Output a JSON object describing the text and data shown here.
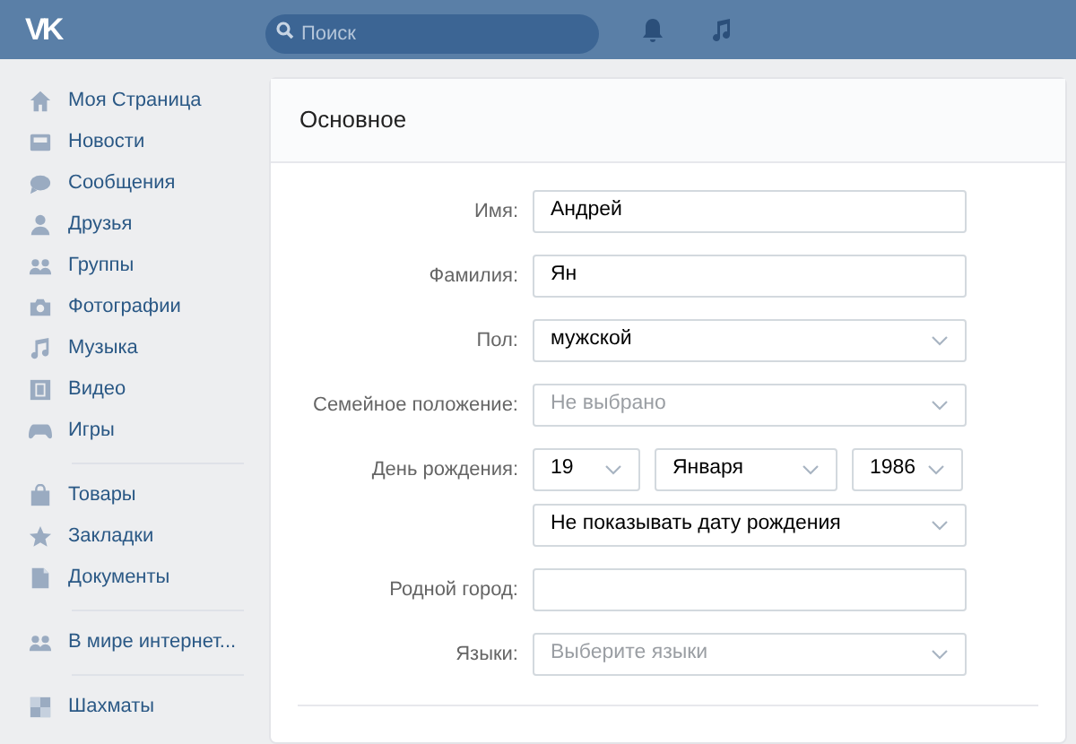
{
  "header": {
    "logo": "VK",
    "search": {
      "placeholder": "Поиск"
    }
  },
  "sidebar": {
    "groups": [
      {
        "items": [
          {
            "label": "Моя Страница"
          },
          {
            "label": "Новости"
          },
          {
            "label": "Сообщения"
          },
          {
            "label": "Друзья"
          },
          {
            "label": "Группы"
          },
          {
            "label": "Фотографии"
          },
          {
            "label": "Музыка"
          },
          {
            "label": "Видео"
          },
          {
            "label": "Игры"
          }
        ]
      },
      {
        "items": [
          {
            "label": "Товары"
          },
          {
            "label": "Закладки"
          },
          {
            "label": "Документы"
          }
        ]
      },
      {
        "items": [
          {
            "label": "В мире интернет..."
          }
        ]
      },
      {
        "items": [
          {
            "label": "Шахматы"
          }
        ]
      }
    ]
  },
  "card": {
    "title": "Основное",
    "rows": [
      {
        "label": "Имя:",
        "controls": [
          {
            "kind": "text",
            "value": "Андрей"
          }
        ]
      },
      {
        "label": "Фамилия:",
        "controls": [
          {
            "kind": "text",
            "value": "Ян"
          }
        ]
      },
      {
        "label": "Пол:",
        "controls": [
          {
            "kind": "select",
            "value": "мужской"
          }
        ]
      },
      {
        "label": "Семейное положение:",
        "controls": [
          {
            "kind": "select",
            "placeholder": "Не выбрано"
          }
        ]
      },
      {
        "label": "День рождения:",
        "controls": [
          {
            "kind": "select",
            "value": "19"
          },
          {
            "kind": "select",
            "value": "Января"
          },
          {
            "kind": "select",
            "value": "1986"
          }
        ]
      },
      {
        "controls": [
          {
            "kind": "select",
            "value": "Не показывать дату рождения"
          }
        ]
      },
      {
        "label": "Родной город:",
        "controls": [
          {
            "kind": "text"
          }
        ]
      },
      {
        "label": "Языки:",
        "controls": [
          {
            "kind": "select",
            "placeholder": "Выберите языки"
          }
        ]
      }
    ]
  }
}
